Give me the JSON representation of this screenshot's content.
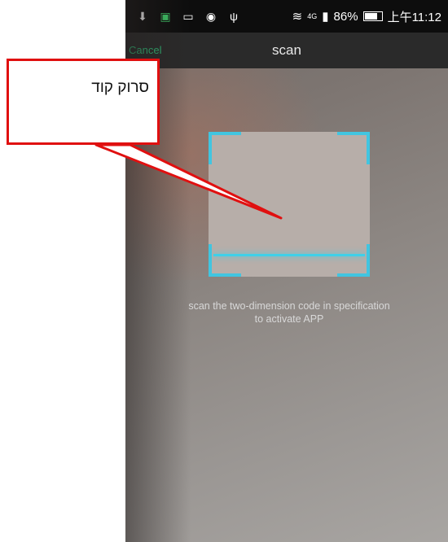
{
  "status_bar": {
    "icons": [
      "download-icon",
      "image-icon",
      "gallery-icon",
      "globe-icon",
      "usb-icon"
    ],
    "network": "4G",
    "battery_percent": "86%",
    "battery_level": 0.86,
    "time": "上午11:12"
  },
  "title_bar": {
    "cancel_label": "Cancel",
    "title": "scan"
  },
  "scanner": {
    "instruction_line1": "scan the two-dimension code in specification",
    "instruction_line2": "to activate APP"
  },
  "annotation": {
    "label": "סרוק קוד",
    "color": "#e01010"
  },
  "colors": {
    "accent": "#41c5e0",
    "cancel": "#2fbf7a"
  }
}
